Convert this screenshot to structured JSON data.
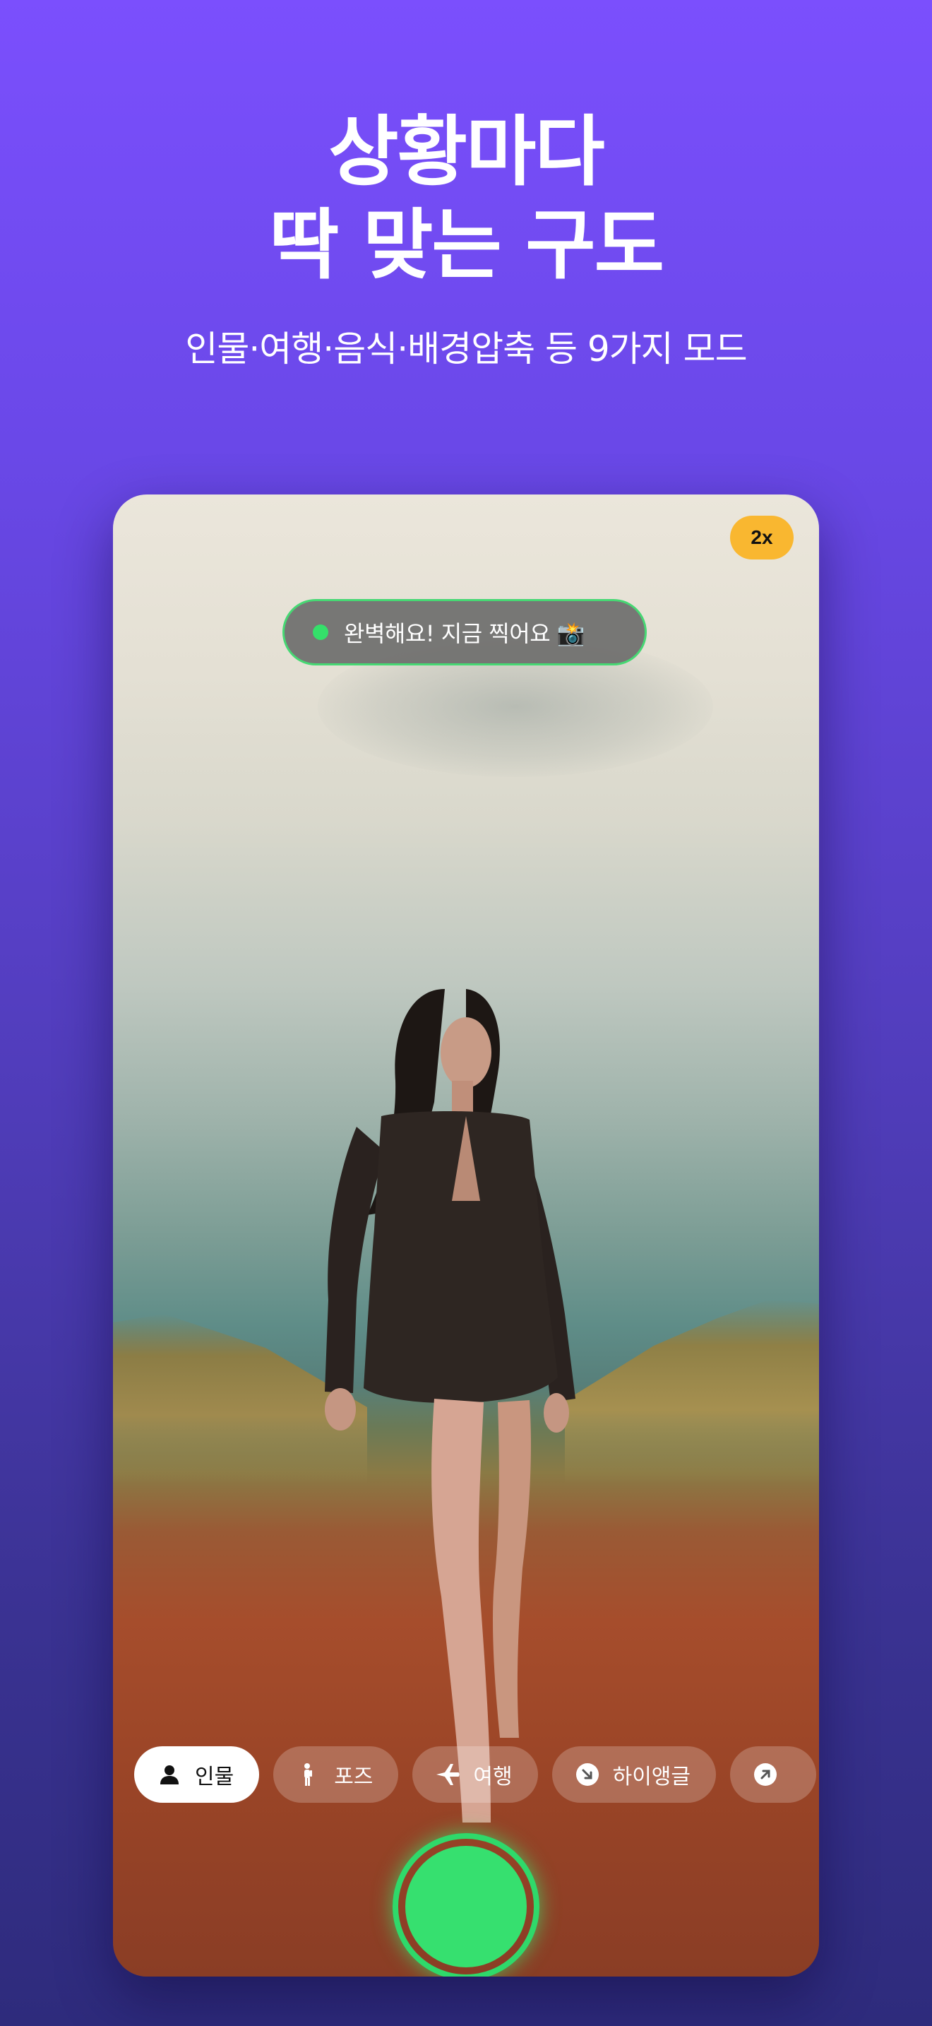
{
  "headline": {
    "line1": "상황마다",
    "line2": "딱 맞는 구도"
  },
  "subtitle": "인물·여행·음식·배경압축 등 9가지 모드",
  "camera": {
    "zoom_label": "2x",
    "status": {
      "text": "완벽해요! 지금 찍어요 📸",
      "color": "#34e06a"
    },
    "modes": [
      {
        "label": "인물",
        "icon": "person-icon",
        "active": true
      },
      {
        "label": "포즈",
        "icon": "pose-icon",
        "active": false
      },
      {
        "label": "여행",
        "icon": "airplane-icon",
        "active": false
      },
      {
        "label": "하이앵글",
        "icon": "arrow-down-right-circle-icon",
        "active": false
      },
      {
        "label": "",
        "icon": "arrow-up-right-circle-icon",
        "active": false
      }
    ],
    "shutter_icon": "shutter-button-icon"
  },
  "colors": {
    "accent_green": "#34e06a",
    "zoom_badge": "#f9b730",
    "background_top": "#7b4ffd",
    "background_bottom": "#2e2b7c"
  }
}
